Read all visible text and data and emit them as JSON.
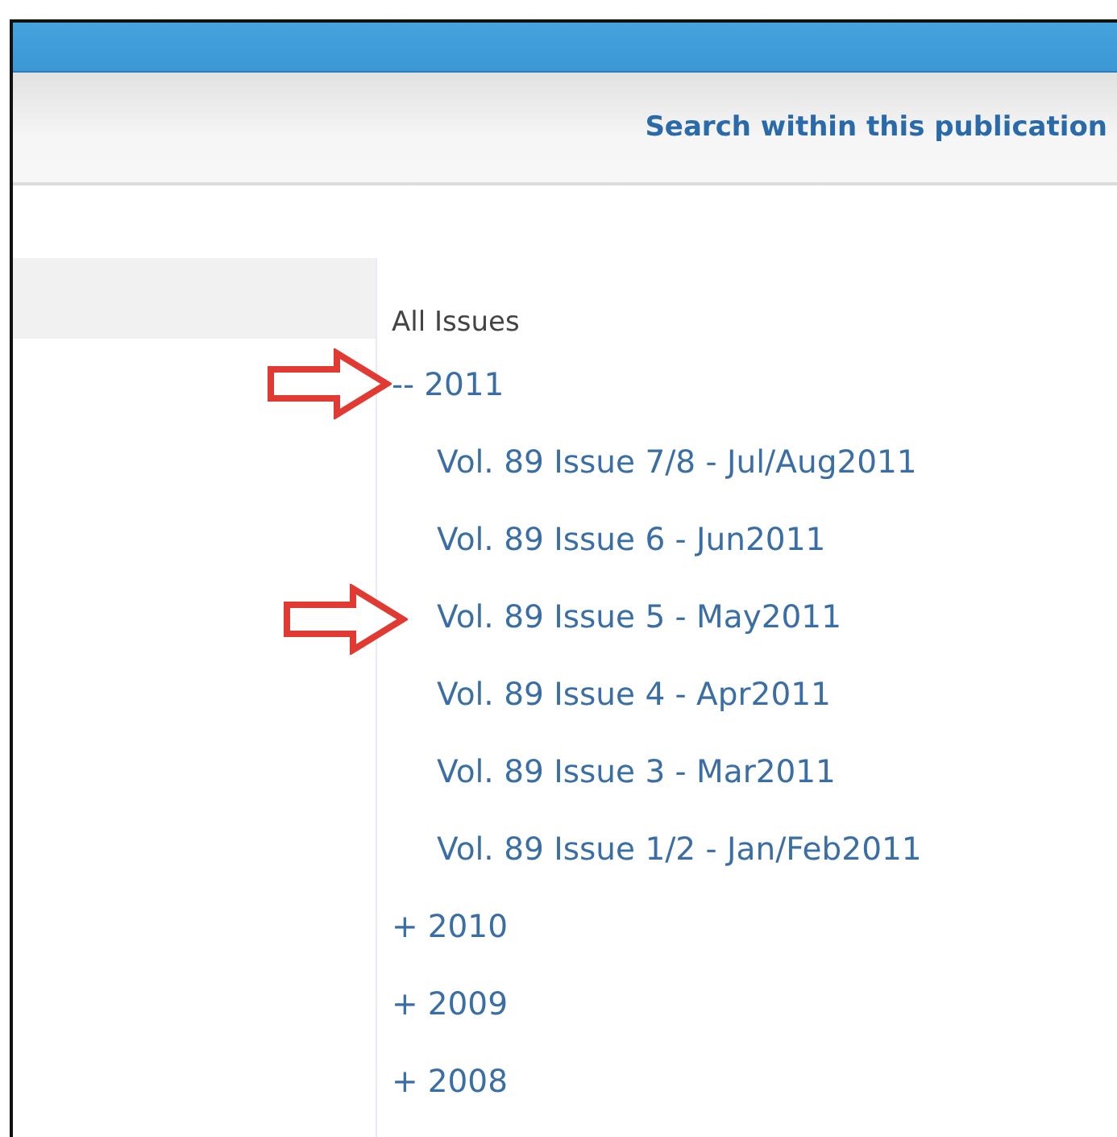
{
  "toolbar": {
    "link": "Search within this publication"
  },
  "issues": {
    "heading": "All Issues",
    "years": [
      {
        "toggle": "--",
        "label": "2011",
        "marked": true,
        "children": [
          {
            "label": "Vol. 89 Issue 7/8 - Jul/Aug2011",
            "marked": false
          },
          {
            "label": "Vol. 89 Issue 6 - Jun2011",
            "marked": false
          },
          {
            "label": "Vol. 89 Issue 5 - May2011",
            "marked": true
          },
          {
            "label": "Vol. 89 Issue 4 - Apr2011",
            "marked": false
          },
          {
            "label": "Vol. 89 Issue 3 - Mar2011",
            "marked": false
          },
          {
            "label": "Vol. 89 Issue 1/2 - Jan/Feb2011",
            "marked": false
          }
        ]
      },
      {
        "toggle": "+",
        "label": "2010",
        "marked": false
      },
      {
        "toggle": "+",
        "label": "2009",
        "marked": false
      },
      {
        "toggle": "+",
        "label": "2008",
        "marked": false
      }
    ]
  }
}
